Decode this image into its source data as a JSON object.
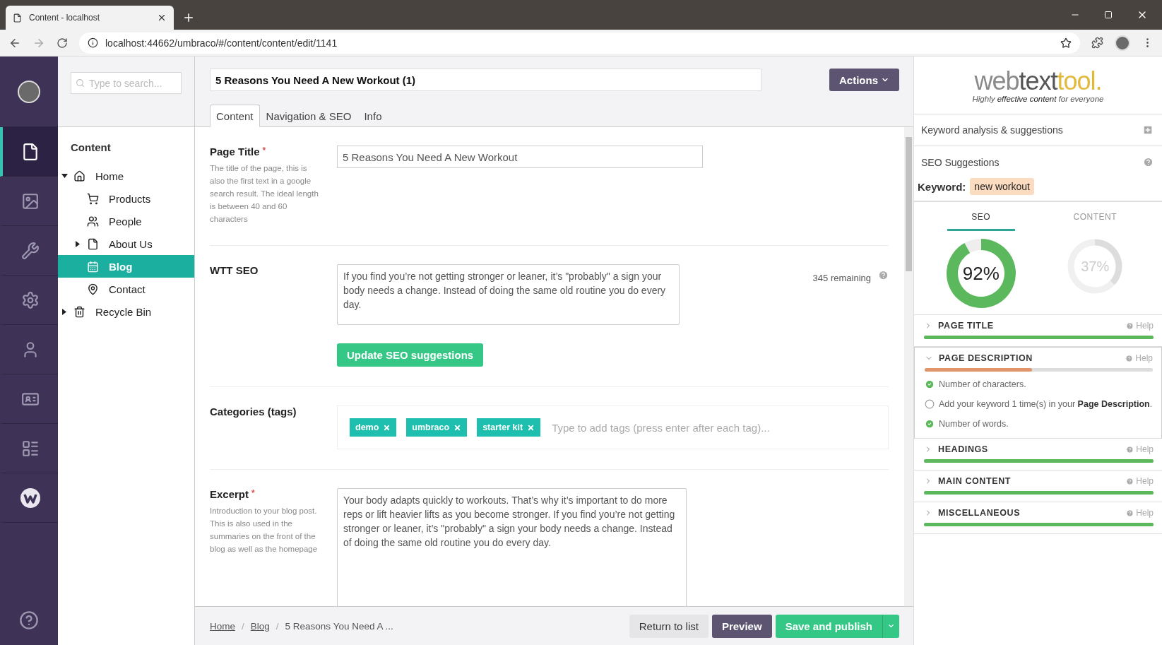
{
  "browser": {
    "tab_title": "Content - localhost",
    "url": "localhost:44662/umbraco/#/content/content/edit/1141"
  },
  "nav": [
    {
      "kind": "document",
      "selected": true
    },
    {
      "kind": "media",
      "selected": false
    },
    {
      "kind": "wrench",
      "selected": false
    },
    {
      "kind": "gear",
      "selected": false
    },
    {
      "kind": "user",
      "selected": false
    },
    {
      "kind": "card",
      "selected": false
    },
    {
      "kind": "form",
      "selected": false
    },
    {
      "kind": "w-logo",
      "selected": false
    }
  ],
  "tree": {
    "search_placeholder": "Type to search...",
    "heading": "Content",
    "items": [
      {
        "label": "Home",
        "kind": "home",
        "expanded": true,
        "selected": false,
        "children": [
          {
            "label": "Products",
            "kind": "cart",
            "selected": false
          },
          {
            "label": "People",
            "kind": "people",
            "selected": false
          },
          {
            "label": "About Us",
            "kind": "page",
            "expanded": false,
            "selected": false
          },
          {
            "label": "Blog",
            "kind": "calendar",
            "selected": true
          },
          {
            "label": "Contact",
            "kind": "pin",
            "selected": false
          }
        ]
      },
      {
        "label": "Recycle Bin",
        "kind": "trash",
        "expanded": false,
        "selected": false
      }
    ]
  },
  "editor": {
    "title": "5 Reasons You Need A New Workout (1)",
    "actions": "Actions",
    "tabs": [
      {
        "label": "Content",
        "selected": true
      },
      {
        "label": "Navigation & SEO",
        "selected": false
      },
      {
        "label": "Info",
        "selected": false
      }
    ],
    "fields": [
      {
        "kind": "text",
        "label": "Page Title",
        "required_mark": "*",
        "description": "The title of the page, this is also the first text in a google search result. The ideal length is between 40 and 60 characters",
        "value": "5 Reasons You Need A New Workout"
      },
      {
        "kind": "seo",
        "label": "WTT SEO",
        "value": "If you find you’re not getting stronger or leaner, it’s \"probably\" a sign your body needs a change. Instead of doing the same old routine you do every day.",
        "counter": "345 remaining",
        "button": "Update SEO suggestions"
      },
      {
        "kind": "tags",
        "label": "Categories (tags)",
        "tags": [
          "demo",
          "umbraco",
          "starter kit"
        ],
        "placeholder": "Type to add tags (press enter after each tag)..."
      },
      {
        "kind": "textarea",
        "label": "Excerpt",
        "required_mark": "*",
        "description": "Introduction to your blog post. This is also used in the summaries on the front of the blog as well as the homepage",
        "value": "Your body adapts quickly to workouts. That’s why it’s important to do more reps or lift heavier lifts as you become stronger. If you find you’re not getting stronger or leaner, it’s \"probably\" a sign your body needs a change. Instead of doing the same old routine you do every day."
      }
    ]
  },
  "footer": {
    "separator": "/",
    "breadcrumbs": [
      {
        "label": "Home",
        "link": true
      },
      {
        "label": "Blog",
        "link": true
      },
      {
        "label": "5 Reasons You Need A ...",
        "link": false
      }
    ],
    "return": "Return to list",
    "preview": "Preview",
    "publish": "Save and publish"
  },
  "seo_panel": {
    "logo": [
      {
        "text": "web",
        "color": "#8a8a8a"
      },
      {
        "text": "text",
        "color": "#555555"
      },
      {
        "text": "tool.",
        "color": "#e2b93b"
      }
    ],
    "tagline": "Highly **effective content** for everyone",
    "keyword_analysis": "Keyword analysis & suggestions",
    "seo_suggestions": "SEO Suggestions",
    "keyword_label": "Keyword:",
    "keyword": "new workout",
    "scores": [
      {
        "label": "SEO",
        "selected": true,
        "value": "92%"
      },
      {
        "label": "CONTENT",
        "selected": false,
        "value": "37%"
      }
    ],
    "sections": [
      {
        "title": "PAGE TITLE",
        "help": "Help",
        "expanded": false,
        "level": 1,
        "color": "#5cb85c"
      },
      {
        "title": "PAGE DESCRIPTION",
        "help": "Help",
        "expanded": true,
        "level": 0.47,
        "color": "#e0956a",
        "items": [
          {
            "text": "Number of characters.",
            "checked": true
          },
          {
            "text": "Add your keyword 1 time(s) in your **Page Description**.",
            "checked": false
          },
          {
            "text": "Number of words.",
            "checked": true
          }
        ]
      },
      {
        "title": "HEADINGS",
        "help": "Help",
        "expanded": false,
        "level": 1,
        "color": "#5cb85c"
      },
      {
        "title": "MAIN CONTENT",
        "help": "Help",
        "expanded": false,
        "level": 1,
        "color": "#5cb85c"
      },
      {
        "title": "MISCELLANEOUS",
        "help": "Help",
        "expanded": false,
        "level": 1,
        "color": "#5cb85c"
      }
    ]
  }
}
